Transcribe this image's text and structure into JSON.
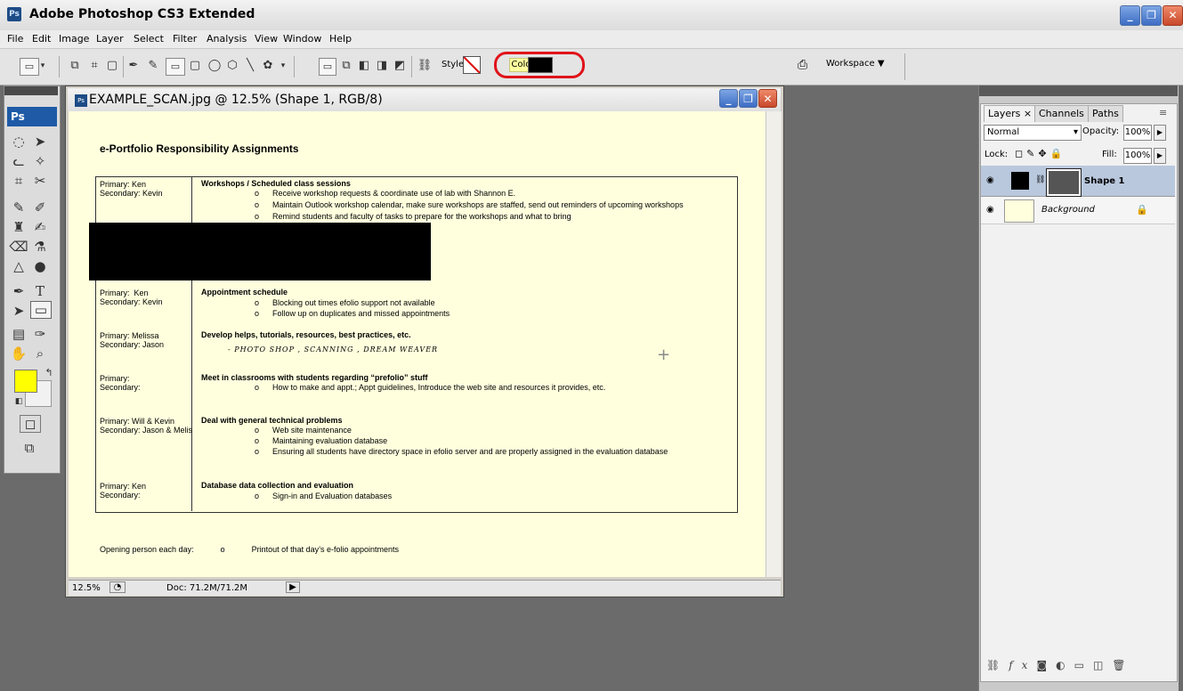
{
  "app": {
    "title": "Adobe Photoshop CS3 Extended",
    "badge": "Ps"
  },
  "window_buttons": {
    "minimize": "_",
    "maximize": "❐",
    "close": "✕"
  },
  "menu": [
    "File",
    "Edit",
    "Image",
    "Layer",
    "Select",
    "Filter",
    "Analysis",
    "View",
    "Window",
    "Help"
  ],
  "options_bar": {
    "style_label": "Style:",
    "color_label": "Color:",
    "color_value": "#000000",
    "workspace_label": "Workspace ▼"
  },
  "toolbox": {
    "logo": "Ps",
    "foreground_color": "#ffff00",
    "background_color": "#f1f1f1"
  },
  "document": {
    "title": "EXAMPLE_SCAN.jpg @ 12.5% (Shape 1, RGB/8)",
    "heading": "e-Portfolio Responsibility Assignments",
    "rows": [
      {
        "left": "Primary: Ken\nSecondary: Kevin",
        "title": "Workshops / Scheduled class sessions",
        "bullets": [
          "Receive workshop requests & coordinate use of lab with Shannon E.",
          "Maintain Outlook workshop calendar, make sure workshops are staffed, send out reminders of upcoming workshops",
          "Remind students and faculty of tasks to prepare for the workshops and what to bring"
        ]
      },
      {
        "left": "Primary:  Ken\nSecondary: Kevin",
        "title": "Appointment schedule",
        "bullets": [
          "Blocking out times efolio support not available",
          "Follow up on duplicates and missed appointments"
        ]
      },
      {
        "left": "Primary: Melissa\nSecondary: Jason",
        "title": "Develop helps, tutorials, resources, best practices, etc.",
        "handwriting": "- PHOTO SHOP ,  SCANNING ,  DREAM WEAVER"
      },
      {
        "left": "Primary:\nSecondary:",
        "title": "Meet in classrooms with students regarding “prefolio” stuff",
        "bullets": [
          "How to make and appt.; Appt guidelines, Introduce the web site and resources it provides, etc."
        ]
      },
      {
        "left": "Primary: Will & Kevin\nSecondary: Jason & Melis",
        "title": "Deal with general  technical problems",
        "bullets": [
          "Web site maintenance",
          "Maintaining evaluation database",
          "Ensuring all students have directory space in efolio server and are properly assigned in the evaluation database"
        ]
      },
      {
        "left": "Primary: Ken\nSecondary:",
        "title": "Database data collection and evaluation",
        "bullets": [
          "Sign-in and Evaluation databases"
        ]
      }
    ],
    "bullet_glyph": "o",
    "opening": "Opening person each day:",
    "opening_item": "Printout of that day’s e-folio appointments",
    "status": {
      "zoom": "12.5%",
      "doc": "Doc: 71.2M/71.2M"
    }
  },
  "layers_panel": {
    "tabs": [
      "Layers ×",
      "Channels",
      "Paths"
    ],
    "blend_mode": "Normal",
    "opacity_label": "Opacity:",
    "opacity": "100%",
    "lock_label": "Lock:",
    "fill_label": "Fill:",
    "fill": "100%",
    "layers": [
      {
        "name": "Shape 1",
        "selected": true
      },
      {
        "name": "Background",
        "locked": true
      }
    ]
  }
}
